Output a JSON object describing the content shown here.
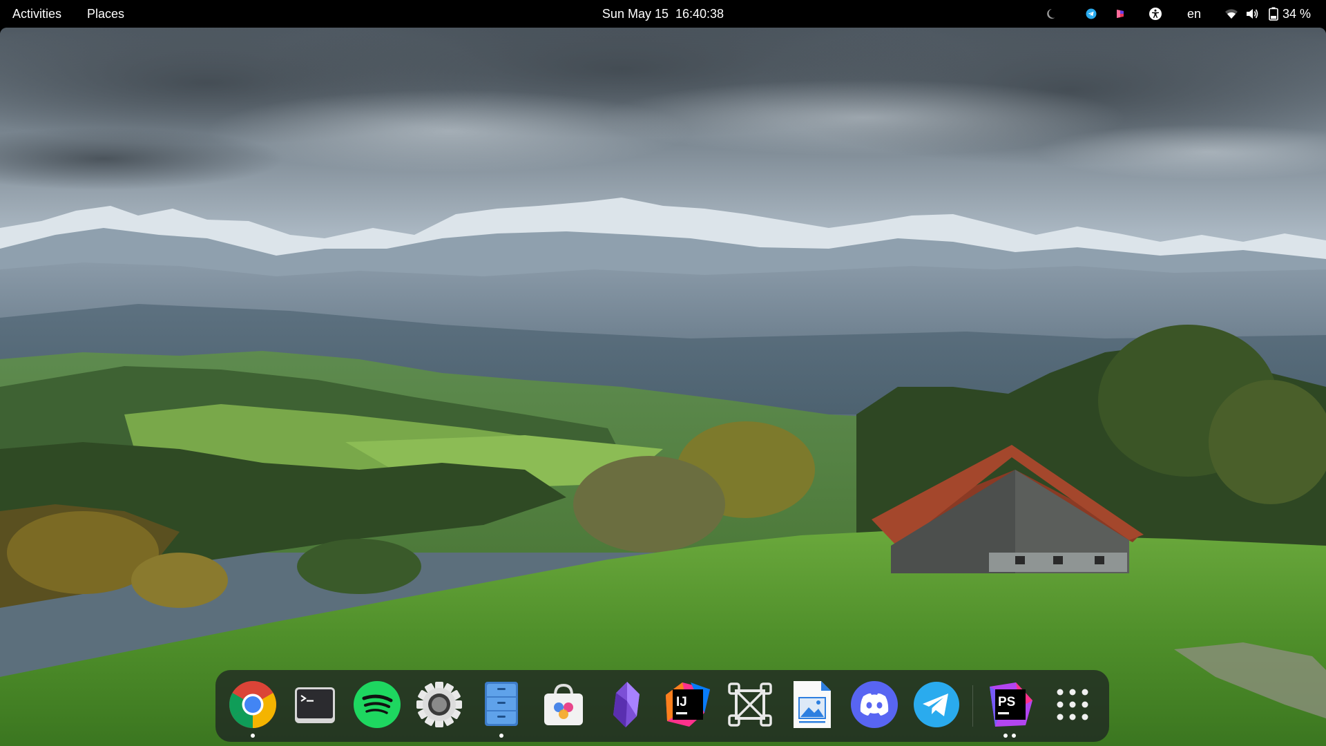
{
  "topbar": {
    "activities": "Activities",
    "places": "Places",
    "date": "Sun May 15",
    "time": "16:40:38",
    "language": "en",
    "battery": "34 %"
  },
  "tray_icons": [
    {
      "name": "night-light-icon"
    },
    {
      "name": "telegram-tray-icon"
    },
    {
      "name": "app-tray-icon"
    },
    {
      "name": "accessibility-icon"
    },
    {
      "name": "wifi-icon"
    },
    {
      "name": "volume-icon"
    },
    {
      "name": "battery-icon"
    }
  ],
  "dock": {
    "apps": [
      {
        "name": "google-chrome",
        "running": true
      },
      {
        "name": "terminal",
        "running": false
      },
      {
        "name": "spotify",
        "running": false
      },
      {
        "name": "settings",
        "running": false
      },
      {
        "name": "files",
        "running": true
      },
      {
        "name": "software-store",
        "running": false
      },
      {
        "name": "obsidian",
        "running": false
      },
      {
        "name": "intellij-idea",
        "running": false
      },
      {
        "name": "screenshot-tool",
        "running": false
      },
      {
        "name": "image-viewer",
        "running": false
      },
      {
        "name": "discord",
        "running": false
      },
      {
        "name": "telegram",
        "running": false
      },
      {
        "name": "phpstorm",
        "running": true
      },
      {
        "name": "show-applications",
        "running": false
      }
    ]
  },
  "colors": {
    "topbar_bg": "#000000",
    "dock_bg": "#1c1e22",
    "chrome_red": "#db4437",
    "chrome_yellow": "#f4b400",
    "chrome_green": "#0f9d58",
    "chrome_blue": "#4285f4",
    "spotify_green": "#1ed760",
    "discord_blurple": "#5865f2",
    "telegram_blue": "#2aabee"
  }
}
